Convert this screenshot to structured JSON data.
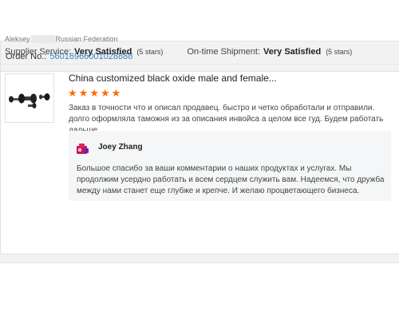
{
  "order": {
    "label": "Order No.:",
    "number": "56016966001028888"
  },
  "buyer": {
    "name": "Aleksey",
    "country": "Russian Federation"
  },
  "ratings": {
    "supplier_label": "Supplier Service:",
    "supplier_value": "Very Satisfied",
    "supplier_stars": "(5 stars)",
    "shipment_label": "On-time Shipment:",
    "shipment_value": "Very Satisfied",
    "shipment_stars": "(5 stars)"
  },
  "product": {
    "title": "China customized black oxide male and female...",
    "rating": 5
  },
  "review": {
    "text": "Заказ в точности что и описал продавец. быстро и четко обработали и отправили. долго оформляла таможня из за описания инвойса а целом все гуд. Будем работать дальше."
  },
  "reply": {
    "author": "Joey Zhang",
    "text": "Большое спасибо за ваши комментарии о наших продуктах и услугах. Мы продолжим усердно работать и всем сердцем служить вам. Надеемся, что дружба между нами станет еще глубже и крепче. И желаю процветающего бизнеса."
  },
  "colors": {
    "link": "#3a7fc1",
    "star": "#ff6a00",
    "reply_bg": "#f5f6f7",
    "bar_bg": "#f2f2f2"
  },
  "icons": {
    "stars": "star-icon",
    "avatar": "supplier-avatar-icon",
    "thumbnail": "product-thumbnail"
  }
}
